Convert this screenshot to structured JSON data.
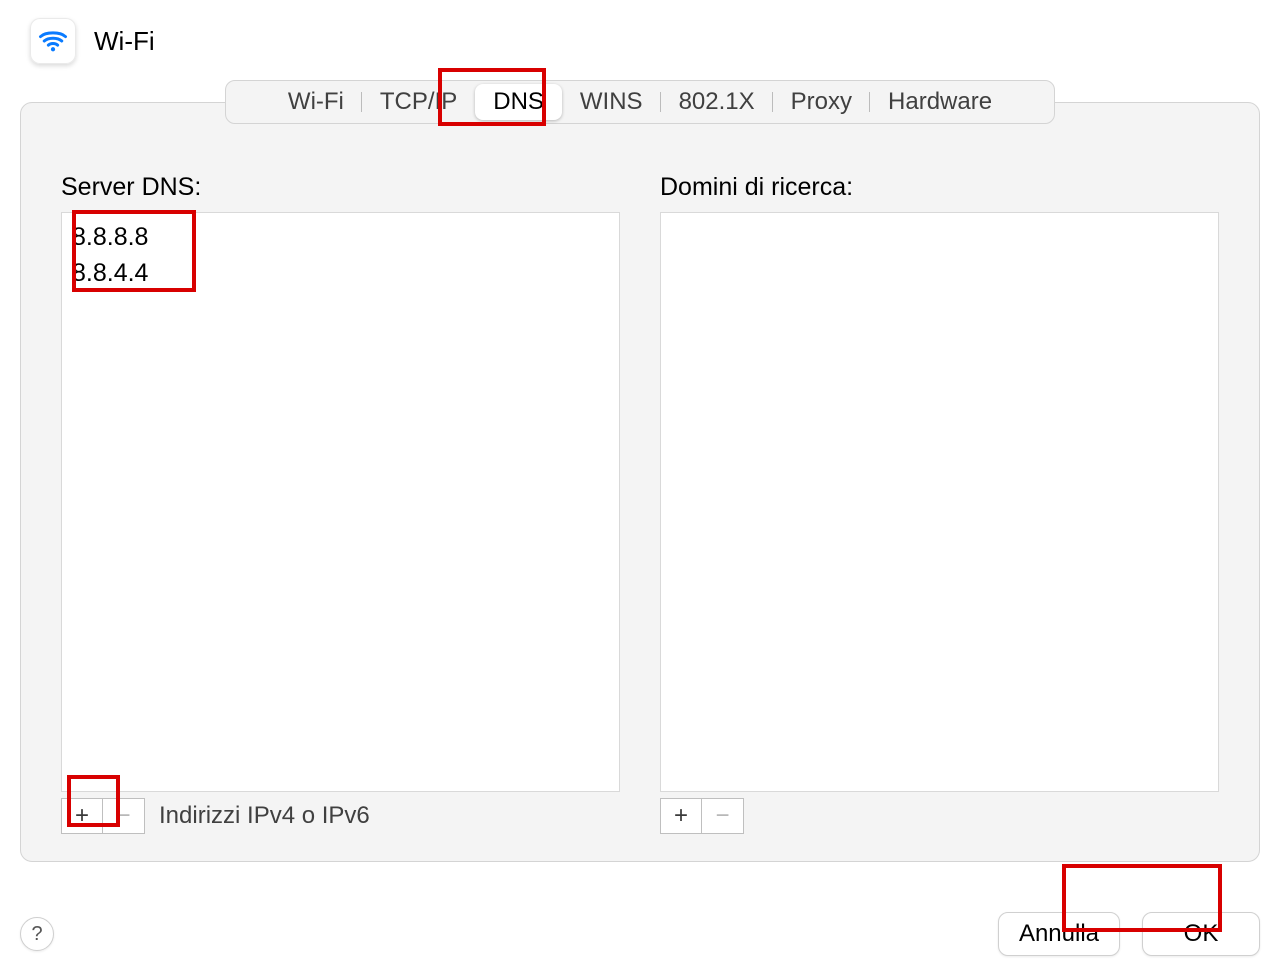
{
  "header": {
    "title": "Wi-Fi"
  },
  "tabs": [
    {
      "id": "wifi",
      "label": "Wi-Fi",
      "active": false
    },
    {
      "id": "tcpip",
      "label": "TCP/IP",
      "active": false
    },
    {
      "id": "dns",
      "label": "DNS",
      "active": true
    },
    {
      "id": "wins",
      "label": "WINS",
      "active": false
    },
    {
      "id": "8021x",
      "label": "802.1X",
      "active": false
    },
    {
      "id": "proxy",
      "label": "Proxy",
      "active": false
    },
    {
      "id": "hardware",
      "label": "Hardware",
      "active": false
    }
  ],
  "dns_panel": {
    "servers_label": "Server DNS:",
    "servers": [
      "8.8.8.8",
      "8.8.4.4"
    ],
    "servers_footer_hint": "Indirizzi IPv4 o IPv6",
    "search_domains_label": "Domini di ricerca:",
    "search_domains": [],
    "add_symbol": "+",
    "remove_symbol": "−"
  },
  "footer": {
    "help_symbol": "?",
    "cancel_label": "Annulla",
    "ok_label": "OK"
  }
}
